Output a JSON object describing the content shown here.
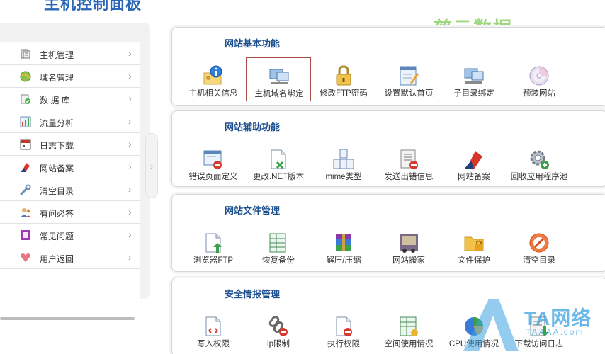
{
  "header": {
    "title": "主机控制面板"
  },
  "watermarks": {
    "top_right": "慈云数据",
    "bottom_right": "TA网络",
    "bottom_right_sub": "TAAAA.com"
  },
  "sidebar": {
    "items": [
      {
        "label": "主机管理",
        "icon": "server-icon"
      },
      {
        "label": "域名管理",
        "icon": "globe-icon"
      },
      {
        "label": "数 据 库",
        "icon": "database-icon"
      },
      {
        "label": "流量分析",
        "icon": "chart-icon"
      },
      {
        "label": "日志下载",
        "icon": "calendar-icon"
      },
      {
        "label": "网站备案",
        "icon": "flag-icon"
      },
      {
        "label": "清空目录",
        "icon": "wrench-icon"
      },
      {
        "label": "有问必答",
        "icon": "users-icon"
      },
      {
        "label": "常见问题",
        "icon": "question-icon"
      },
      {
        "label": "用户返回",
        "icon": "heart-icon"
      }
    ]
  },
  "panels": [
    {
      "title": "网站基本功能",
      "tools": [
        {
          "label": "主机相关信息",
          "icon": "info-icon"
        },
        {
          "label": "主机域名绑定",
          "icon": "network-icon",
          "selected": true
        },
        {
          "label": "修改FTP密码",
          "icon": "lock-icon"
        },
        {
          "label": "设置默认首页",
          "icon": "edit-page-icon"
        },
        {
          "label": "子目录绑定",
          "icon": "network-icon"
        },
        {
          "label": "预装网站",
          "icon": "cd-icon"
        }
      ]
    },
    {
      "title": "网站辅助功能",
      "tools": [
        {
          "label": "错误页面定义",
          "icon": "error-page-icon"
        },
        {
          "label": "更改.NET版本",
          "icon": "file-edit-icon"
        },
        {
          "label": "mime类型",
          "icon": "files-icon"
        },
        {
          "label": "发送出错信息",
          "icon": "document-icon"
        },
        {
          "label": "网站备案",
          "icon": "flag-icon"
        },
        {
          "label": "回收应用程序池",
          "icon": "gear-add-icon"
        }
      ]
    },
    {
      "title": "网站文件管理",
      "tools": [
        {
          "label": "浏览器FTP",
          "icon": "upload-icon"
        },
        {
          "label": "恢复备份",
          "icon": "backup-icon"
        },
        {
          "label": "解压/压缩",
          "icon": "archive-icon"
        },
        {
          "label": "网站搬家",
          "icon": "truck-icon"
        },
        {
          "label": "文件保护",
          "icon": "folder-lock-icon"
        },
        {
          "label": "清空目录",
          "icon": "clear-icon"
        }
      ]
    },
    {
      "title": "安全情报管理",
      "tools": [
        {
          "label": "写入权限",
          "icon": "write-permission-icon"
        },
        {
          "label": "ip限制",
          "icon": "link-block-icon"
        },
        {
          "label": "执行权限",
          "icon": "execute-permission-icon"
        },
        {
          "label": "空间使用情况",
          "icon": "spreadsheet-icon"
        },
        {
          "label": "CPU使用情况",
          "icon": "pie-chart-icon"
        },
        {
          "label": "下载访问日志",
          "icon": "log-download-icon"
        }
      ]
    }
  ],
  "colors": {
    "accent": "#1d4f8f",
    "selected_border": "#a94c47",
    "watermark_green": "#8fd16a",
    "watermark_blue": "#3aa2e2"
  }
}
